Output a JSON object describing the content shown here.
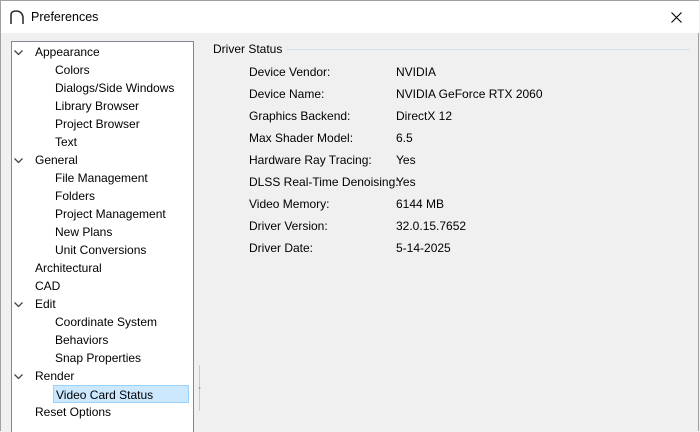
{
  "window": {
    "title": "Preferences",
    "icons": {
      "app": "arc-logo-icon",
      "close": "close-icon"
    }
  },
  "tree": {
    "items": [
      {
        "label": "Appearance",
        "level": 0,
        "expanded": true
      },
      {
        "label": "Colors",
        "level": 1
      },
      {
        "label": "Dialogs/Side Windows",
        "level": 1
      },
      {
        "label": "Library Browser",
        "level": 1
      },
      {
        "label": "Project Browser",
        "level": 1
      },
      {
        "label": "Text",
        "level": 1
      },
      {
        "label": "General",
        "level": 0,
        "expanded": true
      },
      {
        "label": "File Management",
        "level": 1
      },
      {
        "label": "Folders",
        "level": 1
      },
      {
        "label": "Project Management",
        "level": 1
      },
      {
        "label": "New Plans",
        "level": 1
      },
      {
        "label": "Unit Conversions",
        "level": 1
      },
      {
        "label": "Architectural",
        "level": 0
      },
      {
        "label": "CAD",
        "level": 0
      },
      {
        "label": "Edit",
        "level": 0,
        "expanded": true
      },
      {
        "label": "Coordinate System",
        "level": 1
      },
      {
        "label": "Behaviors",
        "level": 1
      },
      {
        "label": "Snap Properties",
        "level": 1
      },
      {
        "label": "Render",
        "level": 0,
        "expanded": true
      },
      {
        "label": "Video Card Status",
        "level": 1,
        "selected": true
      },
      {
        "label": "Reset Options",
        "level": 0
      }
    ]
  },
  "panel": {
    "group_title": "Driver Status",
    "rows": [
      {
        "label": "Device Vendor:",
        "value": "NVIDIA"
      },
      {
        "label": "Device Name:",
        "value": "NVIDIA GeForce RTX 2060"
      },
      {
        "label": "Graphics Backend:",
        "value": "DirectX 12"
      },
      {
        "label": "Max Shader Model:",
        "value": "6.5"
      },
      {
        "label": "Hardware Ray Tracing:",
        "value": "Yes"
      },
      {
        "label": "DLSS Real-Time Denoising:",
        "value": "Yes"
      },
      {
        "label": "Video Memory:",
        "value": "6144 MB"
      },
      {
        "label": "Driver Version:",
        "value": "32.0.15.7652"
      },
      {
        "label": "Driver Date:",
        "value": "5-14-2025"
      }
    ]
  },
  "colors": {
    "selection_bg": "#cce8ff",
    "selection_border": "#99d1ff",
    "tree_border": "#828790",
    "dialog_bg": "#f0f0f0"
  }
}
